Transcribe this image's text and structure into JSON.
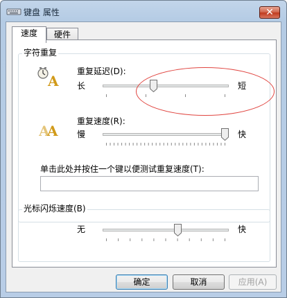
{
  "window": {
    "title": "键盘 属性",
    "close_label": "✕"
  },
  "tabs": [
    {
      "label": "速度",
      "active": true
    },
    {
      "label": "硬件",
      "active": false
    }
  ],
  "char_repeat": {
    "title": "字符重复",
    "delay": {
      "label": "重复延迟(D):",
      "min_label": "长",
      "max_label": "短",
      "value": 0.4
    },
    "rate": {
      "label": "重复速度(R):",
      "min_label": "慢",
      "max_label": "快",
      "value": 1.0
    },
    "test": {
      "label": "单击此处并按住一个键以便测试重复速度(T):",
      "value": ""
    }
  },
  "cursor_blink": {
    "title": "光标闪烁速度(B)",
    "min_label": "无",
    "max_label": "快",
    "value": 0.6
  },
  "buttons": {
    "ok": "确定",
    "cancel": "取消",
    "apply": "应用(A)"
  },
  "colors": {
    "annotation_ring": "#e0443f",
    "default_button_border": "#3c7fb1"
  }
}
